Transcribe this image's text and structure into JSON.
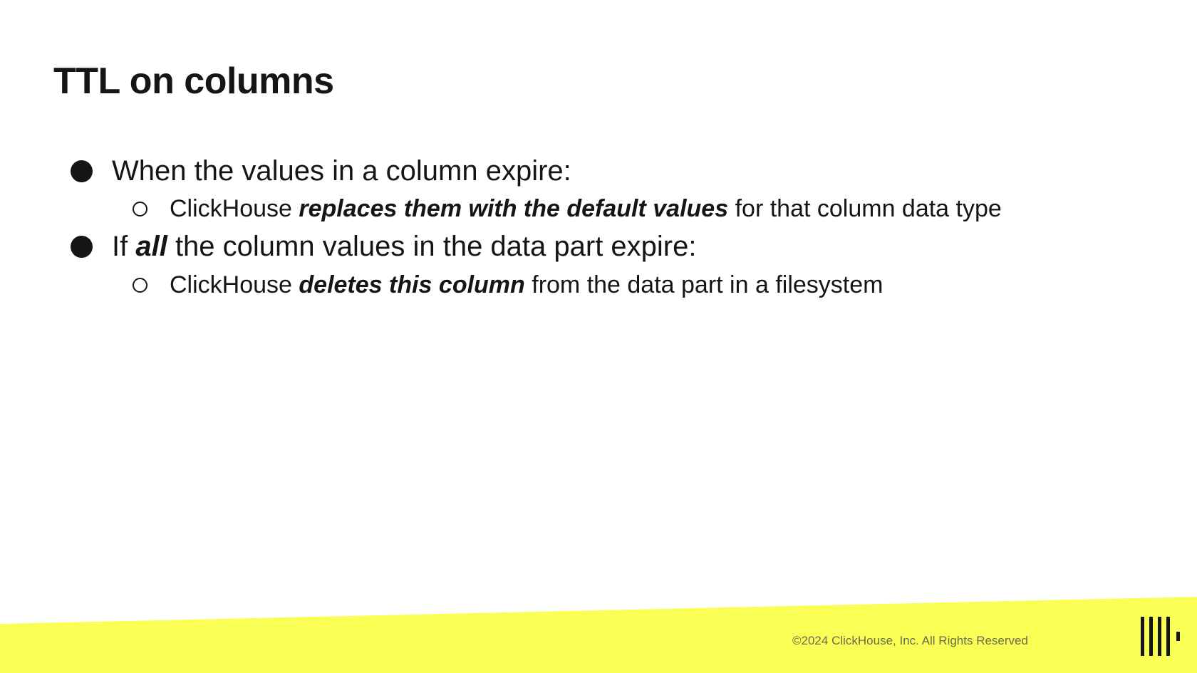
{
  "slide": {
    "title": "TTL on columns"
  },
  "bullets": [
    {
      "level": 1,
      "parts": [
        "When the values in a column expire:"
      ]
    },
    {
      "level": 2,
      "parts": [
        "ClickHouse ",
        "replaces them with the default values",
        " for that column data type"
      ]
    },
    {
      "level": 1,
      "parts": [
        "If ",
        "all",
        " the column values in the data part expire:"
      ]
    },
    {
      "level": 2,
      "parts": [
        "ClickHouse ",
        "deletes this column",
        " from the data part in a filesystem"
      ]
    }
  ],
  "footer": {
    "copyright": "©2024 ClickHouse, Inc. All Rights Reserved",
    "band_color": "#faff56",
    "logo_icon": "clickhouse-bars-icon"
  }
}
